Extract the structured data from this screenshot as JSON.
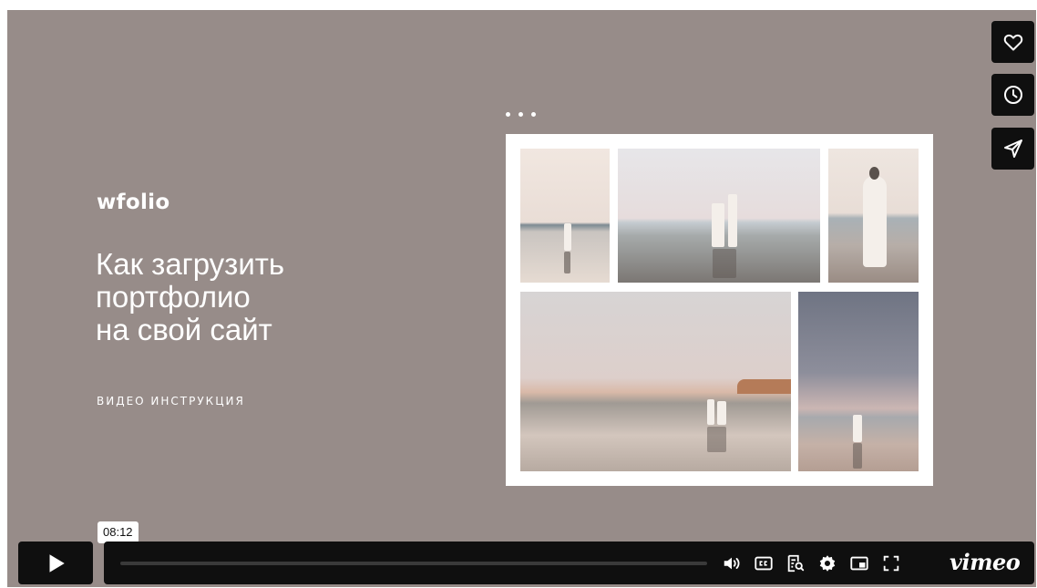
{
  "slide": {
    "brand": "wfolio",
    "headline_lines": [
      "Как загрузить",
      "портфолио",
      "на свой сайт"
    ],
    "subtitle": "ВИДЕО ИНСТРУКЦИЯ"
  },
  "side_actions": [
    {
      "name": "like",
      "icon": "heart-icon"
    },
    {
      "name": "watch-later",
      "icon": "clock-icon"
    },
    {
      "name": "share",
      "icon": "send-icon"
    }
  ],
  "controls": {
    "duration_tooltip": "08:12",
    "progress": 0,
    "icons": [
      "play-icon",
      "volume-icon",
      "cc-icon",
      "transcript-icon",
      "settings-icon",
      "pip-icon",
      "fullscreen-icon"
    ],
    "brand_logo": "vimeo"
  },
  "colors": {
    "background": "#978c89",
    "control_bg": "#0f0f0f",
    "text": "#ffffff"
  }
}
